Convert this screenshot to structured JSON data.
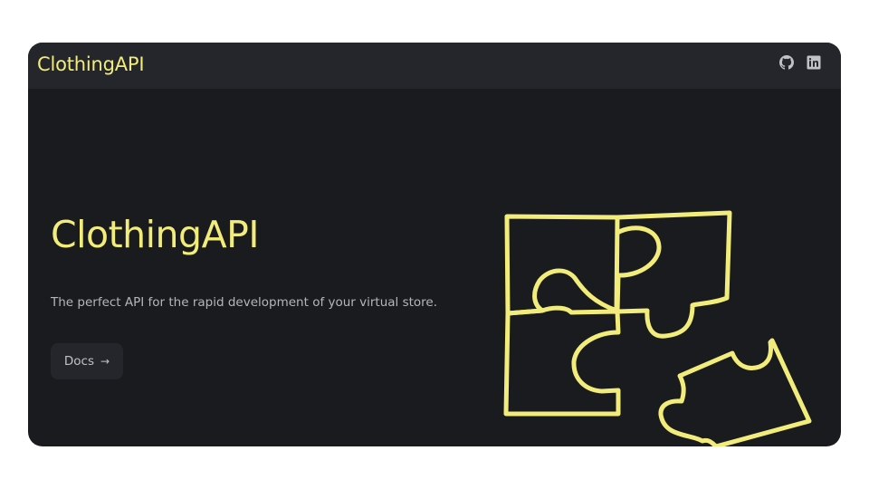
{
  "header": {
    "brand": "ClothingAPI",
    "icons": [
      "github-icon",
      "linkedin-icon"
    ]
  },
  "hero": {
    "title": "ClothingAPI",
    "subtitle": "The perfect API for the rapid development of your virtual store.",
    "docs_label": "Docs",
    "docs_icon": "arrow-right-icon"
  },
  "colors": {
    "accent": "#f2ec7a",
    "background": "#1a1b1e",
    "surface": "#25262b",
    "text_muted": "#b5b6bb"
  }
}
